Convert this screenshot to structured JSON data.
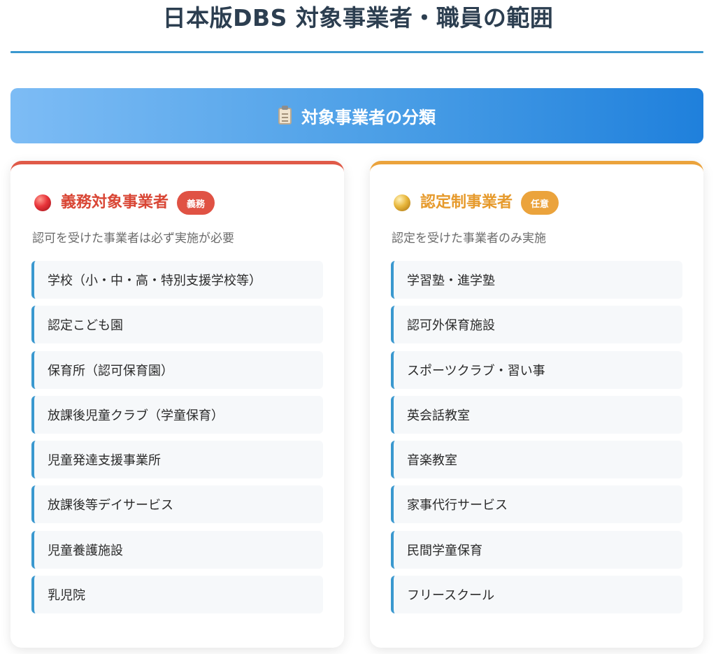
{
  "page": {
    "title": "日本版DBS 対象事業者・職員の範囲"
  },
  "section": {
    "icon": "clipboard-icon",
    "title": "対象事業者の分類"
  },
  "mandatory": {
    "icon": "red-circle-icon",
    "title": "義務対象事業者",
    "badge": "義務",
    "description": "認可を受けた事業者は必ず実施が必要",
    "items": [
      "学校（小・中・高・特別支援学校等）",
      "認定こども園",
      "保育所（認可保育園）",
      "放課後児童クラブ（学童保育）",
      "児童発達支援事業所",
      "放課後等デイサービス",
      "児童養護施設",
      "乳児院"
    ]
  },
  "certified": {
    "icon": "yellow-circle-icon",
    "title": "認定制事業者",
    "badge": "任意",
    "description": "認定を受けた事業者のみ実施",
    "items": [
      "学習塾・進学塾",
      "認可外保育施設",
      "スポーツクラブ・習い事",
      "英会話教室",
      "音楽教室",
      "家事代行サービス",
      "民間学童保育",
      "フリースクール"
    ]
  },
  "colors": {
    "heading": "#2c3e50",
    "accent_blue": "#3a98cf",
    "mandatory_red": "#e05244",
    "certified_orange": "#eba33c"
  }
}
